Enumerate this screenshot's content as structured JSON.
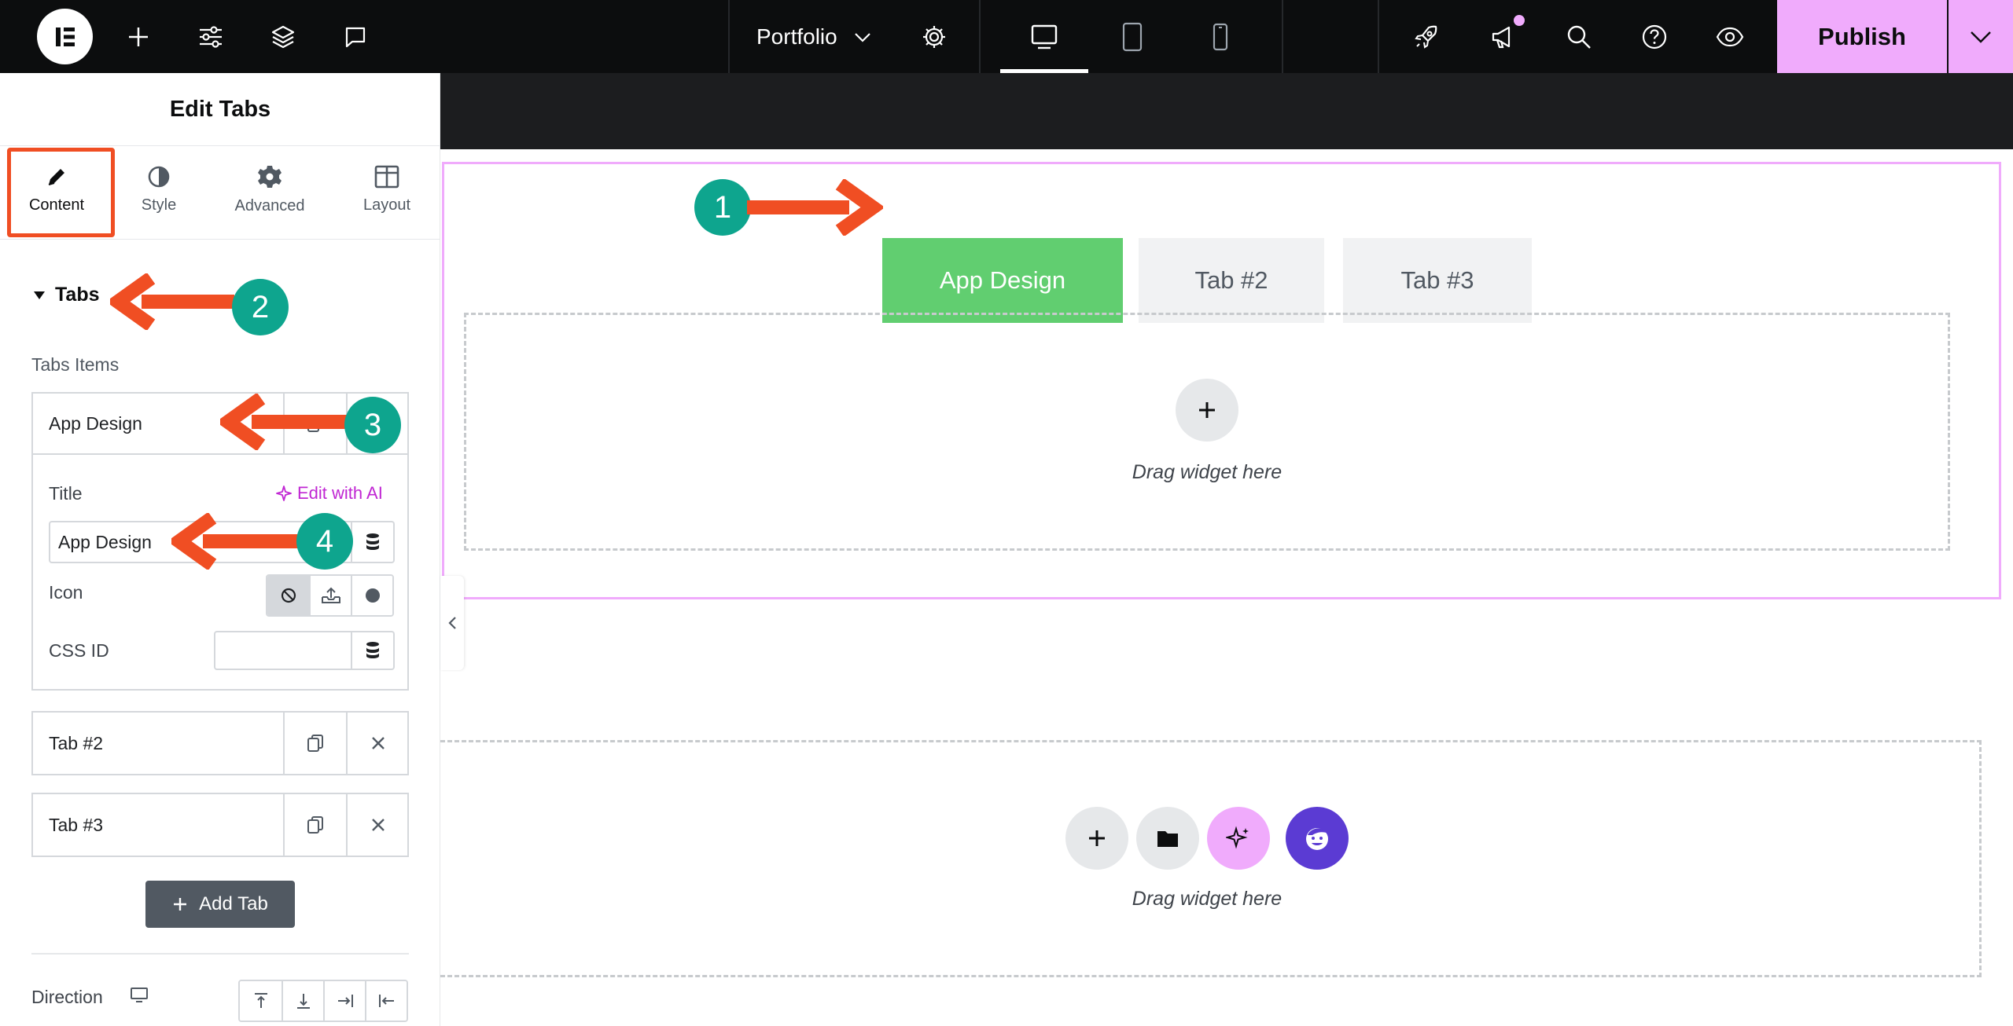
{
  "topbar": {
    "page_name": "Portfolio",
    "publish_label": "Publish"
  },
  "panel": {
    "title": "Edit Tabs",
    "tabs": [
      {
        "label": "Content"
      },
      {
        "label": "Style"
      },
      {
        "label": "Advanced"
      },
      {
        "label": "Layout"
      }
    ],
    "active_tab": "Content",
    "section_title": "Tabs",
    "items_label": "Tabs Items",
    "items": [
      {
        "title": "App Design"
      },
      {
        "title": "Tab #2"
      },
      {
        "title": "Tab #3"
      }
    ],
    "expanded_item": {
      "title_label": "Title",
      "edit_ai_label": "Edit with AI",
      "title_value": "App Design",
      "icon_label": "Icon",
      "css_id_label": "CSS ID",
      "css_id_value": ""
    },
    "add_tab_label": "Add Tab",
    "direction_label": "Direction"
  },
  "canvas": {
    "tabs": [
      {
        "label": "App Design",
        "active": true
      },
      {
        "label": "Tab #2",
        "active": false
      },
      {
        "label": "Tab #3",
        "active": false
      }
    ],
    "drop_hint_1": "Drag widget here",
    "drop_hint_2": "Drag widget here"
  },
  "annotations": [
    "1",
    "2",
    "3",
    "4"
  ],
  "colors": {
    "accent_pink": "#f0abfc",
    "active_tab_green": "#61ce70",
    "annotation_arrow": "#f04e23",
    "annotation_badge": "#0ea58e",
    "ai_purple": "#c026d3",
    "assistant_violet": "#5b3bd3"
  }
}
